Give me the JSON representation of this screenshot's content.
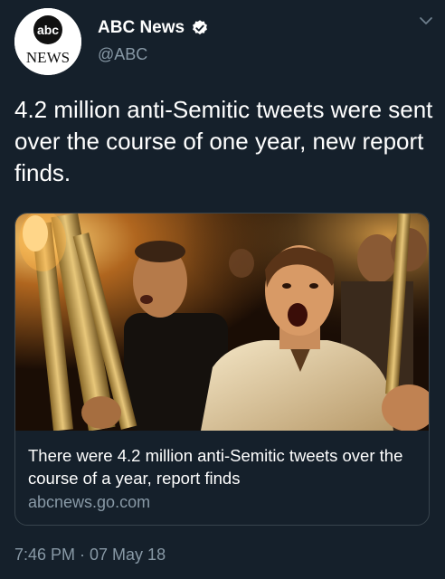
{
  "account": {
    "display_name": "ABC News",
    "handle": "@ABC",
    "avatar_logo_top": "abc",
    "avatar_logo_bottom": "NEWS"
  },
  "tweet": {
    "text": "4.2 million anti-Semitic tweets were sent over the course of one year, new report finds.",
    "timestamp": "7:46 PM · 07 May 18"
  },
  "card": {
    "title": "There were 4.2 million anti-Semitic tweets over the course of a year, report finds",
    "domain": "abcnews.go.com"
  },
  "icons": {
    "verified": "verified-badge-icon",
    "menu": "chevron-down-icon"
  },
  "colors": {
    "background": "#15202b",
    "primary_text": "#ffffff",
    "secondary_text": "#8899a6",
    "border": "#38444d"
  }
}
